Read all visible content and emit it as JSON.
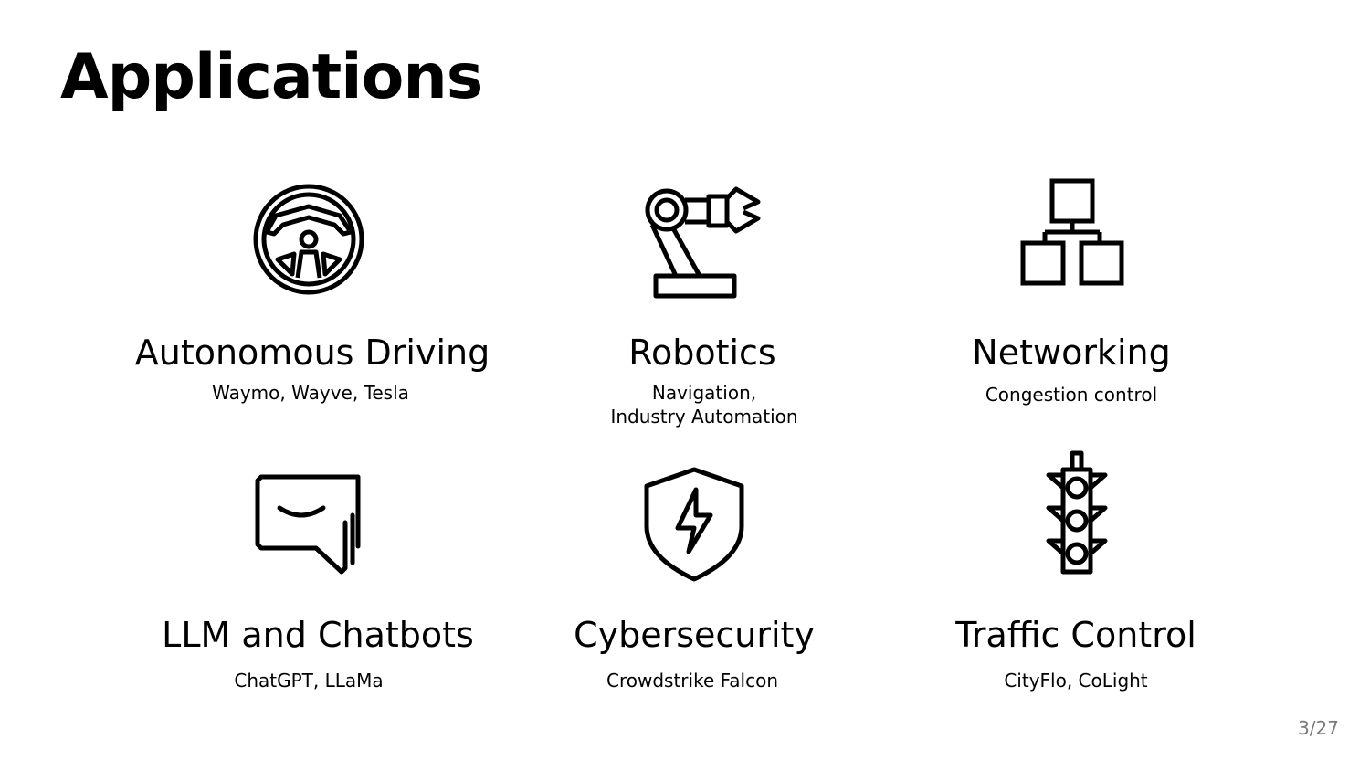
{
  "slide": {
    "title": "Applications",
    "page_number": "3/27"
  },
  "applications": [
    {
      "icon": "steering-wheel-icon",
      "title": "Autonomous Driving",
      "subtitle": [
        "Waymo, Wayve, Tesla"
      ]
    },
    {
      "icon": "robot-arm-icon",
      "title": "Robotics",
      "subtitle": [
        "Navigation,",
        "Industry Automation"
      ]
    },
    {
      "icon": "network-icon",
      "title": "Networking",
      "subtitle": [
        "Congestion control"
      ]
    },
    {
      "icon": "chat-bubble-icon",
      "title": "LLM and Chatbots",
      "subtitle": [
        "ChatGPT, LLaMa"
      ]
    },
    {
      "icon": "shield-bolt-icon",
      "title": "Cybersecurity",
      "subtitle": [
        "Crowdstrike Falcon"
      ]
    },
    {
      "icon": "traffic-light-icon",
      "title": "Traffic Control",
      "subtitle": [
        "CityFlo, CoLight"
      ]
    }
  ]
}
